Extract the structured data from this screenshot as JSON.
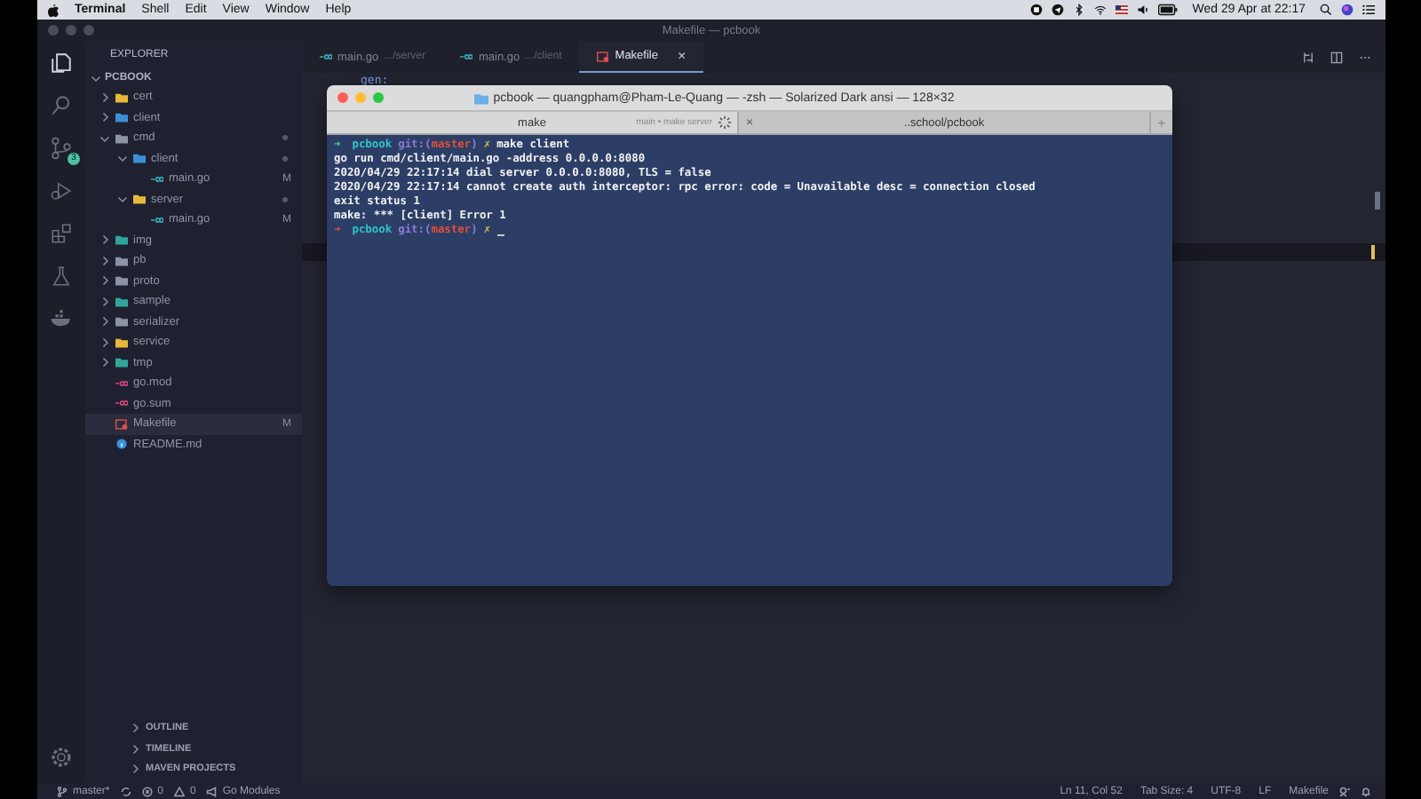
{
  "menubar": {
    "app": "Terminal",
    "menus": [
      "Shell",
      "Edit",
      "View",
      "Window",
      "Help"
    ],
    "clock": "Wed 29 Apr at 22:17"
  },
  "window": {
    "title": "Makefile — pcbook"
  },
  "activity_bar": {
    "source_control_badge": "3"
  },
  "explorer": {
    "title": "EXPLORER",
    "root": "PCBOOK",
    "items": [
      {
        "name": "cert",
        "kind": "folder",
        "color": "#e8b83a",
        "expanded": false
      },
      {
        "name": "client",
        "kind": "folder",
        "color": "#3d8fd6",
        "expanded": false
      },
      {
        "name": "cmd",
        "kind": "folder",
        "color": "#8b93a7",
        "expanded": true,
        "dot": true,
        "children": [
          {
            "name": "client",
            "kind": "folder",
            "color": "#3d8fd6",
            "expanded": true,
            "dot": true,
            "children": [
              {
                "name": "main.go",
                "kind": "go",
                "status": "M"
              }
            ]
          },
          {
            "name": "server",
            "kind": "folder",
            "color": "#e8b83a",
            "expanded": true,
            "dot": true,
            "children": [
              {
                "name": "main.go",
                "kind": "go",
                "status": "M"
              }
            ]
          }
        ]
      },
      {
        "name": "img",
        "kind": "folder",
        "color": "#2fa79a",
        "expanded": false
      },
      {
        "name": "pb",
        "kind": "folder",
        "color": "#8b93a7",
        "expanded": false
      },
      {
        "name": "proto",
        "kind": "folder",
        "color": "#8b93a7",
        "expanded": false
      },
      {
        "name": "sample",
        "kind": "folder",
        "color": "#2fa79a",
        "expanded": false
      },
      {
        "name": "serializer",
        "kind": "folder",
        "color": "#8b93a7",
        "expanded": false
      },
      {
        "name": "service",
        "kind": "folder",
        "color": "#e8b83a",
        "expanded": false
      },
      {
        "name": "tmp",
        "kind": "folder",
        "color": "#2fa79a",
        "expanded": false
      },
      {
        "name": "go.mod",
        "kind": "gomod"
      },
      {
        "name": "go.sum",
        "kind": "gomod"
      },
      {
        "name": "Makefile",
        "kind": "makefile",
        "status": "M",
        "selected": true
      },
      {
        "name": "README.md",
        "kind": "readme",
        "selected": false
      }
    ],
    "sections": [
      "OUTLINE",
      "TIMELINE",
      "MAVEN PROJECTS"
    ]
  },
  "editor_tabs": [
    {
      "label": "main.go",
      "hint": ".../server",
      "kind": "go",
      "selected": false
    },
    {
      "label": "main.go",
      "hint": ".../client",
      "kind": "go",
      "selected": false
    },
    {
      "label": "Makefile",
      "kind": "makefile",
      "selected": true,
      "close": "×"
    }
  ],
  "editor": {
    "first_line": {
      "text": "gen:",
      "kind": "target"
    }
  },
  "terminal": {
    "title": "pcbook — quangpham@Pham-Le-Quang — -zsh — Solarized Dark ansi — 128×32",
    "tabs": [
      {
        "label": "make",
        "hint": "main • make server",
        "busy": true,
        "selected": true
      },
      {
        "label": "..school/pcbook",
        "close": "×",
        "selected": false
      }
    ],
    "new_tab": "+",
    "lines": [
      {
        "kind": "prompt",
        "arrow": "➜",
        "failed": false,
        "dir": "pcbook",
        "git_prefix": "git:(",
        "branch": "master",
        "git_suffix": ")",
        "dirty": "✗",
        "command": "make client"
      },
      {
        "kind": "output",
        "text": "go run cmd/client/main.go -address 0.0.0.0:8080"
      },
      {
        "kind": "output",
        "text": "2020/04/29 22:17:14 dial server 0.0.0.0:8080, TLS = false"
      },
      {
        "kind": "output",
        "text": "2020/04/29 22:17:14 cannot create auth interceptor: rpc error: code = Unavailable desc = connection closed"
      },
      {
        "kind": "output",
        "text": "exit status 1"
      },
      {
        "kind": "output",
        "text": "make: *** [client] Error 1"
      },
      {
        "kind": "prompt",
        "arrow": "➜",
        "failed": true,
        "dir": "pcbook",
        "git_prefix": "git:(",
        "branch": "master",
        "git_suffix": ")",
        "dirty": "✗",
        "cursor": true
      }
    ]
  },
  "status_bar": {
    "branch": "master*",
    "errors": "0",
    "warnings": "0",
    "go": "Go Modules",
    "right": [
      "Ln 11, Col 52",
      "Tab Size: 4",
      "UTF-8",
      "LF",
      "Makefile"
    ]
  }
}
